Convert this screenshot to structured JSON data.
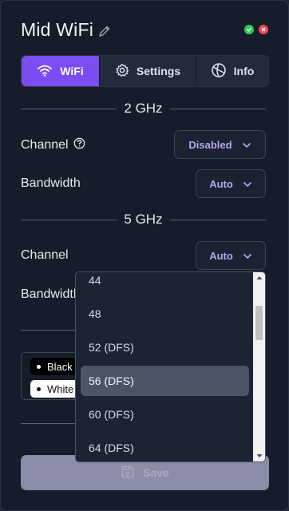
{
  "header": {
    "title": "Mid WiFi",
    "edit_icon": "pencil-icon",
    "status_ok_icon": "check-circle-icon",
    "status_error_icon": "x-circle-icon",
    "status_ok_color": "#35c95a",
    "status_error_color": "#f2495b"
  },
  "tabs": [
    {
      "label": "WiFi",
      "icon": "wifi-icon",
      "active": true
    },
    {
      "label": "Settings",
      "icon": "gear-icon",
      "active": false
    },
    {
      "label": "Info",
      "icon": "info-globe-icon",
      "active": false
    }
  ],
  "accent_color": "#7b4cf2",
  "band_24": {
    "heading": "2 GHz",
    "channel_label": "Channel",
    "channel_help_icon": "question-circle-icon",
    "channel_value": "Disabled",
    "bandwidth_label": "Bandwidth",
    "bandwidth_value": "Auto"
  },
  "band_5": {
    "heading": "5 GHz",
    "channel_label": "Channel",
    "channel_value": "Auto",
    "bandwidth_label": "Bandwidth"
  },
  "channel_dropdown": {
    "options": [
      "44",
      "48",
      "52 (DFS)",
      "56 (DFS)",
      "60 (DFS)",
      "64 (DFS)"
    ],
    "highlighted": "56 (DFS)"
  },
  "theme_chips": [
    {
      "label": "Black"
    },
    {
      "label": "White"
    }
  ],
  "save_button": {
    "label": "Save",
    "icon": "floppy-disk-icon"
  }
}
